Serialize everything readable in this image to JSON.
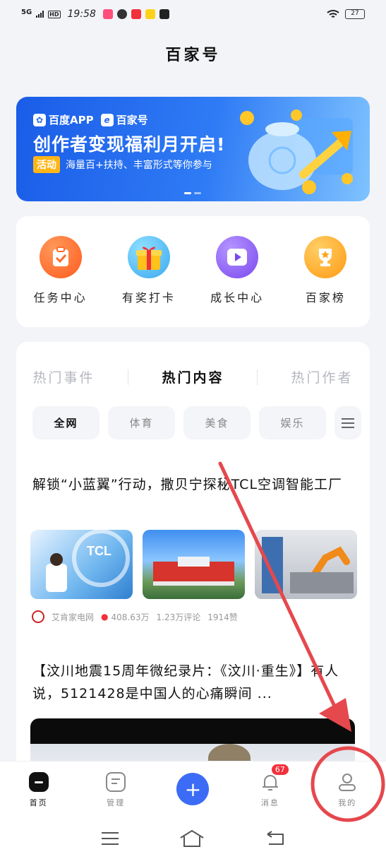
{
  "status_bar": {
    "network": "5G",
    "hd": "HD",
    "time": "19:58",
    "battery": "27"
  },
  "page": {
    "title": "百家号"
  },
  "banner": {
    "brand_1": "百度APP",
    "brand_2": "百家号",
    "headline": "创作者变现福利月开启!",
    "tag": "活动",
    "subtitle": "海量百+扶持、丰富形式等你参与"
  },
  "quick_entries": [
    {
      "label": "任务中心",
      "icon": "clipboard-check-icon",
      "color": "#ff6a2a"
    },
    {
      "label": "有奖打卡",
      "icon": "gift-icon",
      "color": "#ffc21a"
    },
    {
      "label": "成长中心",
      "icon": "play-icon",
      "color": "#8a5cf5"
    },
    {
      "label": "百家榜",
      "icon": "trophy-icon",
      "color": "#ffa41c"
    }
  ],
  "content_tabs": [
    "热门事件",
    "热门内容",
    "热门作者"
  ],
  "active_tab": "热门内容",
  "chips": [
    "全网",
    "体育",
    "美食",
    "娱乐"
  ],
  "articles": [
    {
      "title": "解锁“小蓝翼”行动，撒贝宁探秘TCL空调智能工厂",
      "source": "艾肯家电网",
      "views": "408.63万",
      "comments": "1.23万评论",
      "likes": "1914赞"
    },
    {
      "title": "【汶川地震15周年微纪录片：《汶川·重生》】有人说，5121428是中国人的心痛瞬间 ..."
    }
  ],
  "bottom_nav": [
    {
      "label": "首页",
      "icon": "home-icon",
      "active": true
    },
    {
      "label": "管理",
      "icon": "manage-icon",
      "active": false
    },
    {
      "label": "",
      "icon": "plus-icon",
      "active": false
    },
    {
      "label": "消息",
      "icon": "bell-icon",
      "active": false,
      "badge": "67"
    },
    {
      "label": "我的",
      "icon": "profile-icon",
      "active": false
    }
  ],
  "colors": {
    "accent": "#3c6cf5",
    "annotation": "#e5484d",
    "badge": "#f2303b"
  }
}
